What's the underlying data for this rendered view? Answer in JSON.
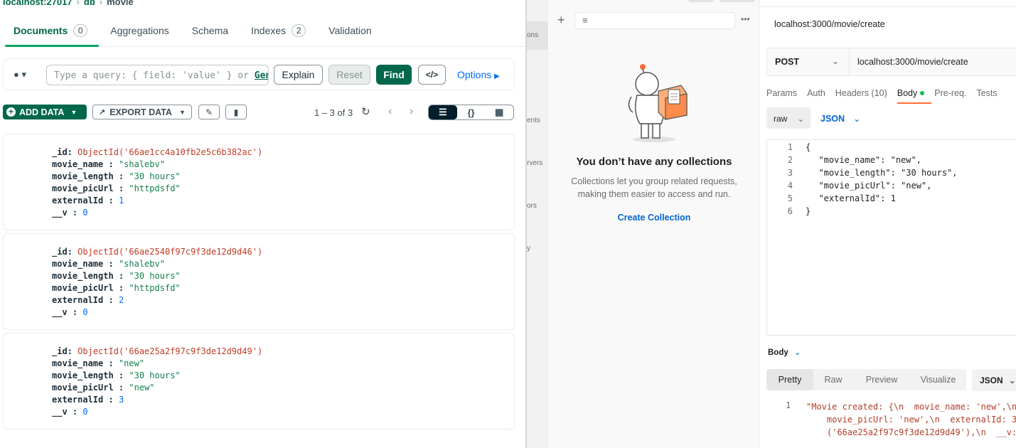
{
  "compass": {
    "breadcrumb": {
      "host": "localhost:27017",
      "db": "db",
      "collection": "movie"
    },
    "tabs": [
      {
        "label": "Documents",
        "badge": "0"
      },
      {
        "label": "Aggregations"
      },
      {
        "label": "Schema"
      },
      {
        "label": "Indexes",
        "badge": "2"
      },
      {
        "label": "Validation"
      }
    ],
    "query": {
      "placeholder": "Type a query: { field: 'value' } or",
      "generate_link": "Gen",
      "explain": "Explain",
      "reset": "Reset",
      "find": "Find",
      "code_icon": "</>",
      "options": "Options"
    },
    "toolbar": {
      "add_data": "ADD DATA",
      "export_data": "EXPORT DATA",
      "count": "1 – 3 of 3"
    },
    "documents": [
      {
        "id": "ObjectId('66ae1cc4a10fb2e5c6b382ac')",
        "movie_name": "\"shalebv\"",
        "movie_length": "\"30 hours\"",
        "movie_picUrl": "\"httpdsfd\"",
        "externalId": "1",
        "v": "0"
      },
      {
        "id": "ObjectId('66ae2540f97c9f3de12d9d46')",
        "movie_name": "\"shalebv\"",
        "movie_length": "\"30 hours\"",
        "movie_picUrl": "\"httpdsfd\"",
        "externalId": "2",
        "v": "0"
      },
      {
        "id": "ObjectId('66ae25a2f97c9f3de12d9d49')",
        "movie_name": "\"new\"",
        "movie_length": "\"30 hours\"",
        "movie_picUrl": "\"new\"",
        "externalId": "3",
        "v": "0"
      }
    ],
    "field_labels": {
      "id": "_id",
      "movie_name": "movie_name",
      "movie_length": "movie_length",
      "movie_picUrl": "movie_picUrl",
      "externalId": "externalId",
      "v": "__v"
    }
  },
  "postman": {
    "side_fragments": [
      "ons",
      "ents",
      "rvers",
      "ors",
      "y"
    ],
    "collections": {
      "empty_title": "You don’t have any collections",
      "empty_desc": "Collections let you group related requests, making them easier to access and run.",
      "create": "Create Collection"
    },
    "request": {
      "title": "localhost:3000/movie/create",
      "method": "POST",
      "url": "localhost:3000/movie/create",
      "tabs": [
        "Params",
        "Auth",
        "Headers (10)",
        "Body",
        "Pre-req.",
        "Tests"
      ],
      "body_mode": "raw",
      "body_format": "JSON",
      "body_lines": [
        "{",
        "  \"movie_name\": \"new\",",
        "  \"movie_length\": \"30 hours\",",
        "  \"movie_picUrl\": \"new\",",
        "  \"externalId\": 1",
        "}"
      ]
    },
    "response": {
      "label": "Body",
      "tabs": [
        "Pretty",
        "Raw",
        "Preview",
        "Visualize"
      ],
      "format": "JSON",
      "line": "1",
      "text": "\"Movie created: {\\n  movie_name: 'new',\\n\n    movie_picUrl: 'new',\\n  externalId: 3\n    ('66ae25a2f97c9f3de12d9d49'),\\n  __v:"
    }
  },
  "colors": {
    "mongo_green": "#00684a",
    "postman_orange": "#ff6c37",
    "link_blue": "#0265d2"
  }
}
